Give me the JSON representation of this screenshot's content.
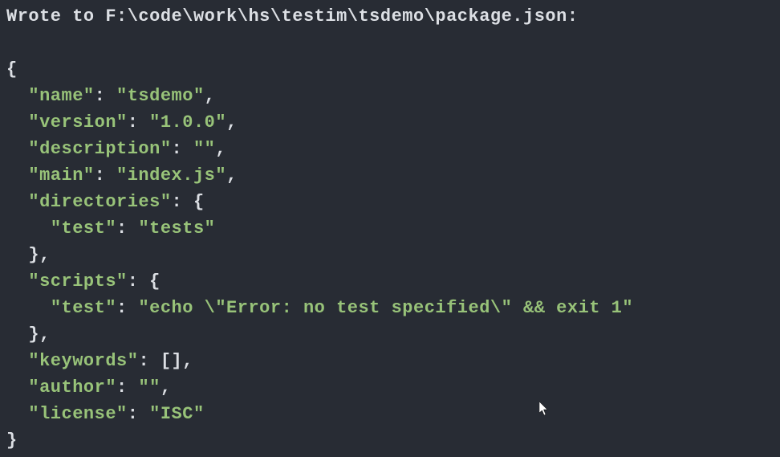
{
  "header": {
    "wrote_to_prefix": "Wrote to ",
    "file_path": "F:\\code\\work\\hs\\testim\\tsdemo\\package.json",
    "colon": ":"
  },
  "json_content": {
    "name_key": "\"name\"",
    "name_val": "\"tsdemo\"",
    "version_key": "\"version\"",
    "version_val": "\"1.0.0\"",
    "description_key": "\"description\"",
    "description_val": "\"\"",
    "main_key": "\"main\"",
    "main_val": "\"index.js\"",
    "directories_key": "\"directories\"",
    "directories_test_key": "\"test\"",
    "directories_test_val": "\"tests\"",
    "scripts_key": "\"scripts\"",
    "scripts_test_key": "\"test\"",
    "scripts_test_val": "\"echo \\\"Error: no test specified\\\" && exit 1\"",
    "keywords_key": "\"keywords\"",
    "keywords_val": "[]",
    "author_key": "\"author\"",
    "author_val": "\"\"",
    "license_key": "\"license\"",
    "license_val": "\"ISC\""
  },
  "punctuation": {
    "open_brace": "{",
    "close_brace": "}",
    "close_brace_comma": "},",
    "colon_space": ": ",
    "comma": ",",
    "indent1": "  ",
    "indent2": "    "
  }
}
